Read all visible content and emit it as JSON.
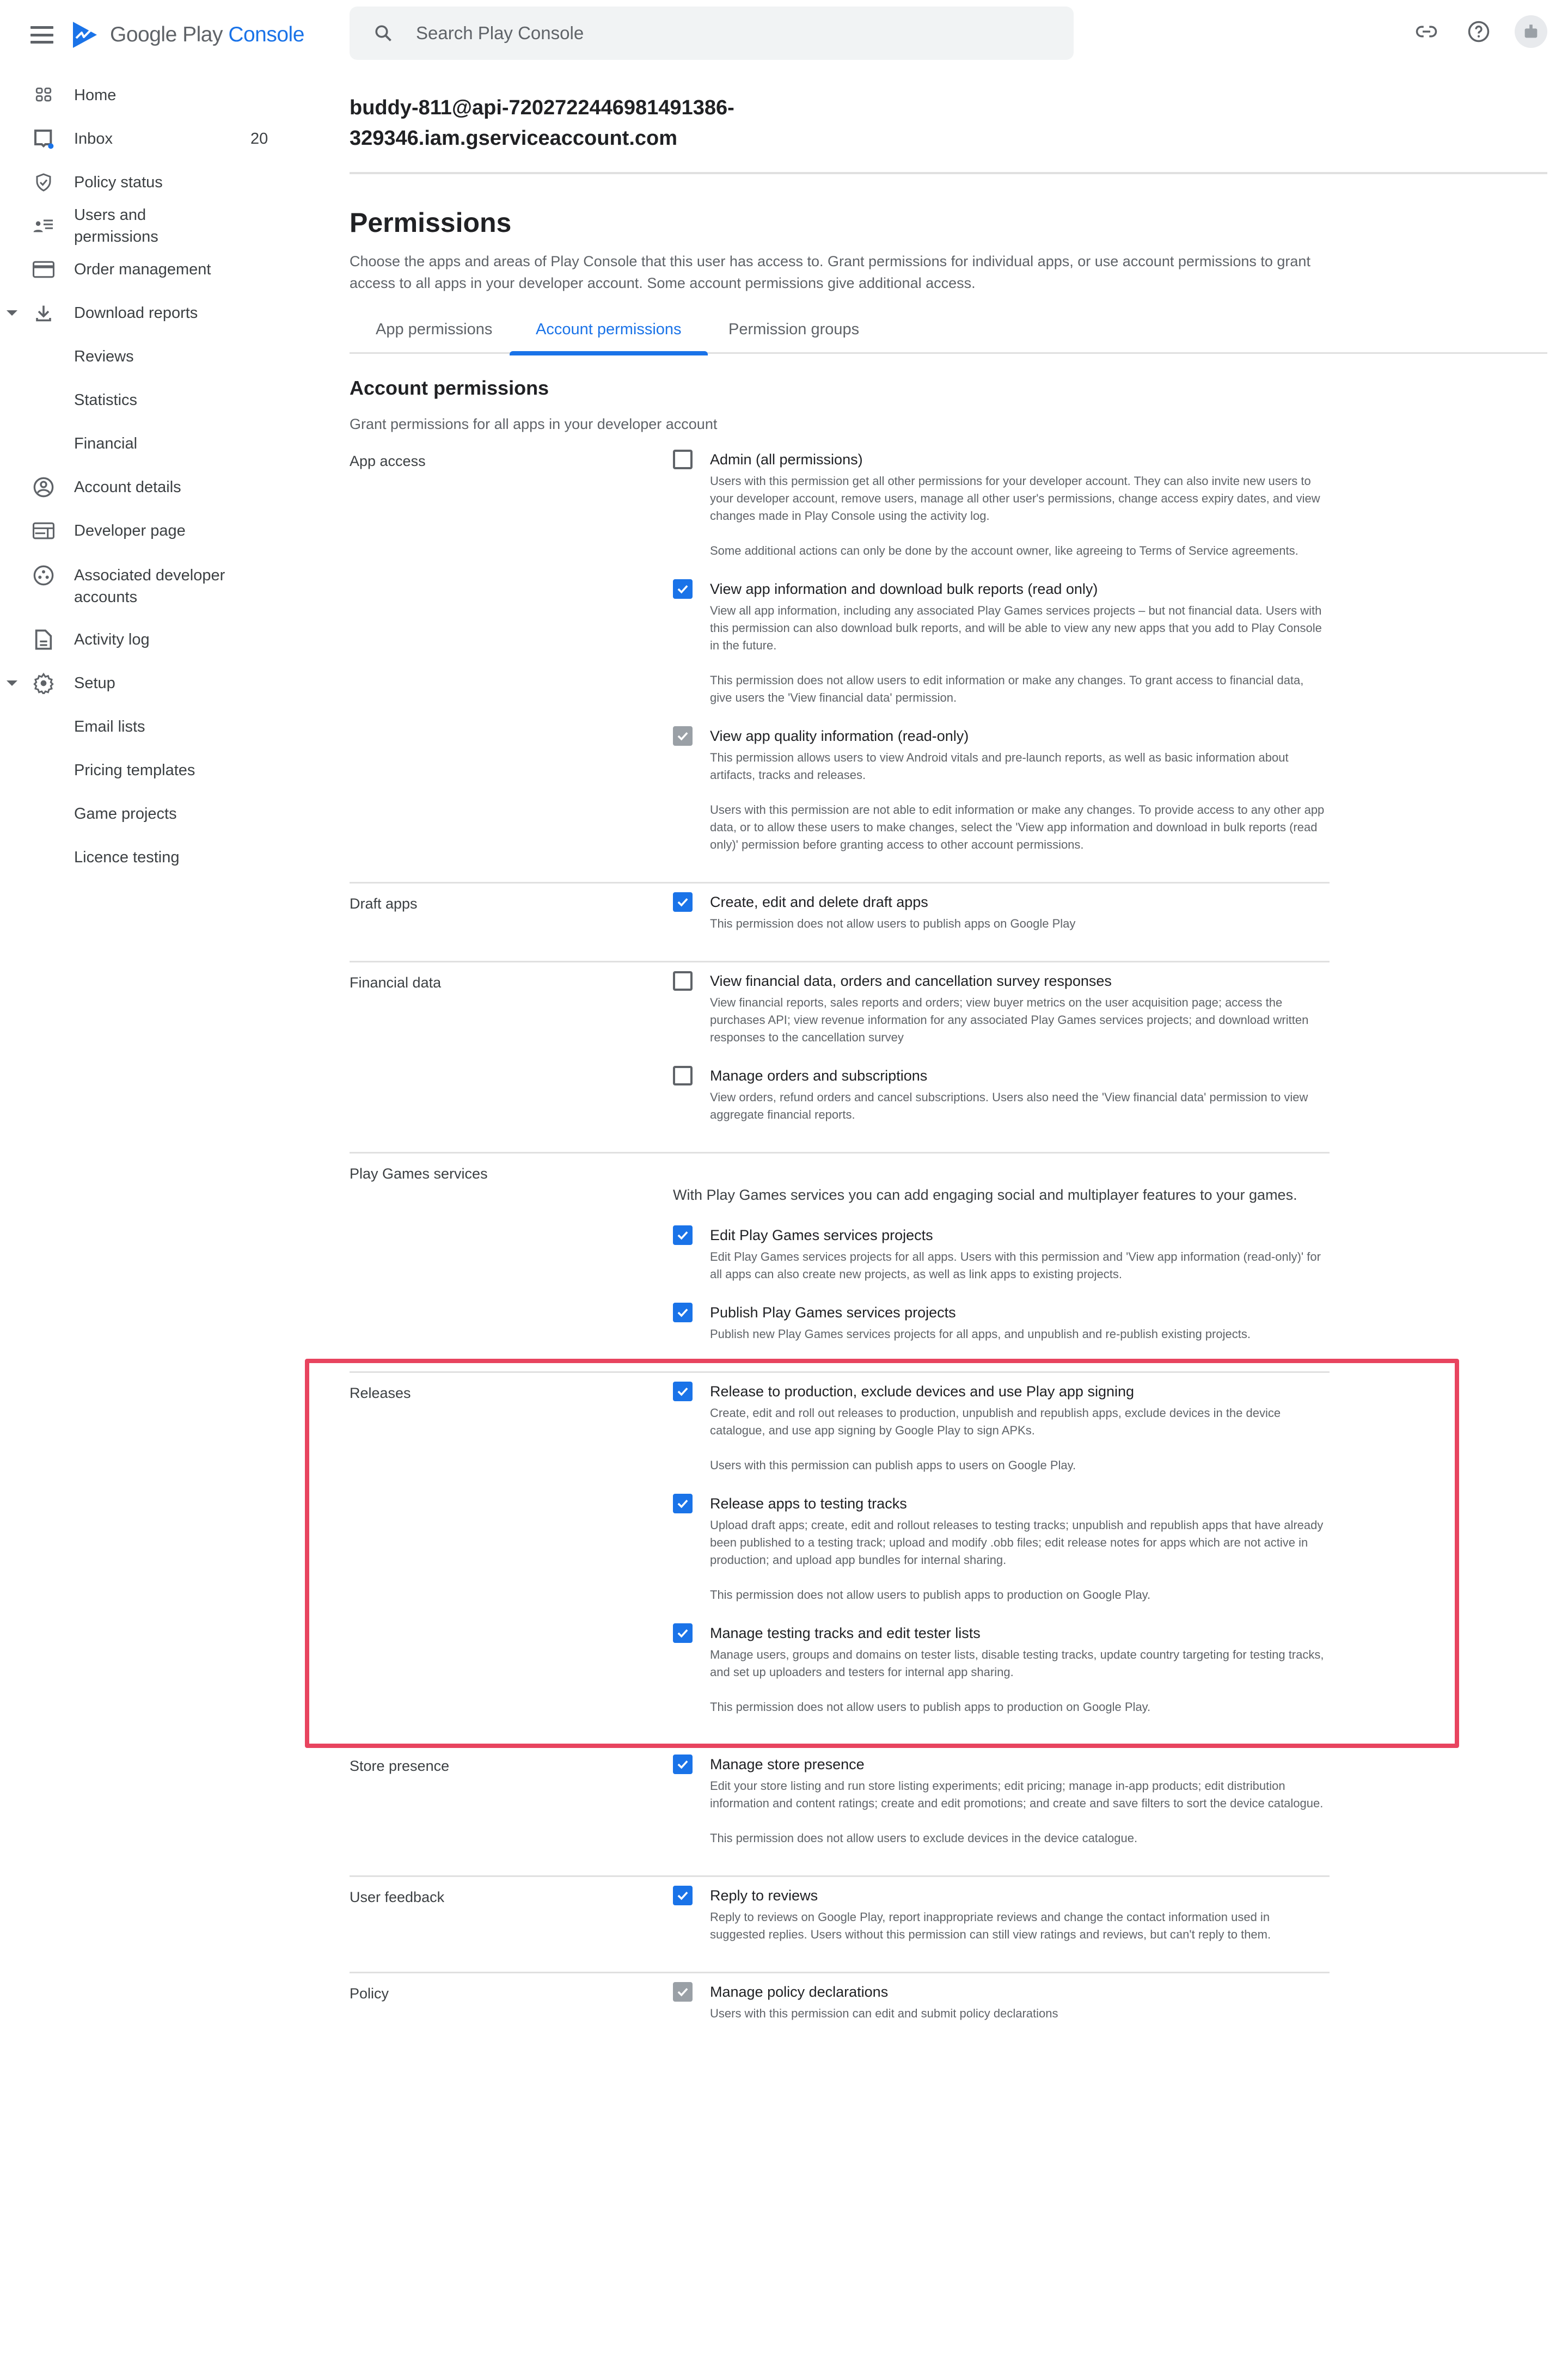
{
  "app": {
    "brand_google_play": "Google Play",
    "brand_console": "Console",
    "accent_color": "#1a73e8",
    "highlight_color": "#e8445f"
  },
  "search": {
    "placeholder": "Search Play Console"
  },
  "top_icons": [
    "link-icon",
    "help-icon",
    "account-avatar"
  ],
  "sidebar": {
    "items": [
      {
        "label": "Home",
        "icon": "home-grid-icon"
      },
      {
        "label": "Inbox",
        "icon": "inbox-icon",
        "count": "20"
      },
      {
        "label": "Policy status",
        "icon": "shield-check-icon"
      },
      {
        "label": "Users and permissions",
        "icon": "users-list-icon"
      },
      {
        "label": "Order management",
        "icon": "credit-card-icon"
      },
      {
        "label": "Download reports",
        "icon": "download-icon",
        "expanded": true
      },
      {
        "label": "Reviews"
      },
      {
        "label": "Statistics"
      },
      {
        "label": "Financial"
      },
      {
        "label": "Account details",
        "icon": "account-circle-icon"
      },
      {
        "label": "Developer page",
        "icon": "developer-page-icon"
      },
      {
        "label": "Associated developer accounts",
        "icon": "associated-accounts-icon"
      },
      {
        "label": "Activity log",
        "icon": "document-icon"
      },
      {
        "label": "Setup",
        "icon": "gear-icon",
        "expanded": true
      },
      {
        "label": "Email lists"
      },
      {
        "label": "Pricing templates"
      },
      {
        "label": "Game projects"
      },
      {
        "label": "Licence testing"
      }
    ]
  },
  "main": {
    "account_email": "buddy-811@api-7202722446981491386-329346.iam.gserviceaccount.com",
    "page_title": "Permissions",
    "page_description": "Choose the apps and areas of Play Console that this user has access to. Grant permissions for individual apps, or use account permissions to grant access to all apps in your developer account. Some account permissions give additional access.",
    "tabs": [
      {
        "label": "App permissions",
        "active": false
      },
      {
        "label": "Account permissions",
        "active": true
      },
      {
        "label": "Permission groups",
        "active": false
      }
    ],
    "section_title": "Account permissions",
    "section_subtitle": "Grant permissions for all apps in your developer account",
    "groups": [
      {
        "label": "App access",
        "permissions": [
          {
            "title": "Admin (all permissions)",
            "state": "unchecked",
            "desc": [
              "Users with this permission get all other permissions for your developer account. They can also invite new users to your developer account, remove users, manage all other user's permissions, change access expiry dates, and view changes made in Play Console using the activity log.",
              "Some additional actions can only be done by the account owner, like agreeing to Terms of Service agreements."
            ]
          },
          {
            "title": "View app information and download bulk reports (read only)",
            "state": "checked",
            "desc": [
              "View all app information, including any associated Play Games services projects – but not financial data. Users with this permission can also download bulk reports, and will be able to view any new apps that you add to Play Console in the future.",
              "This permission does not allow users to edit information or make any changes. To grant access to financial data, give users the 'View financial data' permission."
            ]
          },
          {
            "title": "View app quality information (read-only)",
            "state": "checked-disabled",
            "desc": [
              "This permission allows users to view Android vitals and pre-launch reports, as well as basic information about artifacts, tracks and releases.",
              "Users with this permission are not able to edit information or make any changes. To provide access to any other app data, or to allow these users to make changes, select the 'View app information and download in bulk reports (read only)' permission before granting access to other account permissions."
            ]
          }
        ]
      },
      {
        "label": "Draft apps",
        "permissions": [
          {
            "title": "Create, edit and delete draft apps",
            "state": "checked",
            "desc": [
              "This permission does not allow users to publish apps on Google Play"
            ]
          }
        ]
      },
      {
        "label": "Financial data",
        "permissions": [
          {
            "title": "View financial data, orders and cancellation survey responses",
            "state": "unchecked",
            "desc": [
              "View financial reports, sales reports and orders; view buyer metrics on the user acquisition page; access the purchases API; view revenue information for any associated Play Games services projects; and download written responses to the cancellation survey"
            ]
          },
          {
            "title": "Manage orders and subscriptions",
            "state": "unchecked",
            "desc": [
              "View orders, refund orders and cancel subscriptions. Users also need the 'View financial data' permission to view aggregate financial reports."
            ]
          }
        ]
      },
      {
        "label": "Play Games services",
        "intro": "With Play Games services you can add engaging social and multiplayer features to your games.",
        "permissions": [
          {
            "title": "Edit Play Games services projects",
            "state": "checked",
            "desc": [
              "Edit Play Games services projects for all apps. Users with this permission and 'View app information (read-only)' for all apps can also create new projects, as well as link apps to existing projects."
            ]
          },
          {
            "title": "Publish Play Games services projects",
            "state": "checked",
            "desc": [
              "Publish new Play Games services projects for all apps, and unpublish and re-publish existing projects."
            ]
          }
        ]
      },
      {
        "label": "Releases",
        "highlighted": true,
        "permissions": [
          {
            "title": "Release to production, exclude devices and use Play app signing",
            "state": "checked",
            "desc": [
              "Create, edit and roll out releases to production, unpublish and republish apps, exclude devices in the device catalogue, and use app signing by Google Play to sign APKs.",
              "Users with this permission can publish apps to users on Google Play."
            ]
          },
          {
            "title": "Release apps to testing tracks",
            "state": "checked",
            "desc": [
              "Upload draft apps; create, edit and rollout releases to testing tracks; unpublish and republish apps that have already been published to a testing track; upload and modify .obb files; edit release notes for apps which are not active in production; and upload app bundles for internal sharing.",
              "This permission does not allow users to publish apps to production on Google Play."
            ]
          },
          {
            "title": "Manage testing tracks and edit tester lists",
            "state": "checked",
            "desc": [
              "Manage users, groups and domains on tester lists, disable testing tracks, update country targeting for testing tracks, and set up uploaders and testers for internal app sharing.",
              "This permission does not allow users to publish apps to production on Google Play."
            ]
          }
        ]
      },
      {
        "label": "Store presence",
        "permissions": [
          {
            "title": "Manage store presence",
            "state": "checked",
            "desc": [
              "Edit your store listing and run store listing experiments; edit pricing; manage in-app products; edit distribution information and content ratings; create and edit promotions; and create and save filters to sort the device catalogue.",
              "This permission does not allow users to exclude devices in the device catalogue."
            ]
          }
        ]
      },
      {
        "label": "User feedback",
        "permissions": [
          {
            "title": "Reply to reviews",
            "state": "checked",
            "desc": [
              "Reply to reviews on Google Play, report inappropriate reviews and change the contact information used in suggested replies. Users without this permission can still view ratings and reviews, but can't reply to them."
            ]
          }
        ]
      },
      {
        "label": "Policy",
        "permissions": [
          {
            "title": "Manage policy declarations",
            "state": "checked-disabled",
            "desc": [
              "Users with this permission can edit and submit policy declarations"
            ]
          }
        ]
      }
    ]
  }
}
